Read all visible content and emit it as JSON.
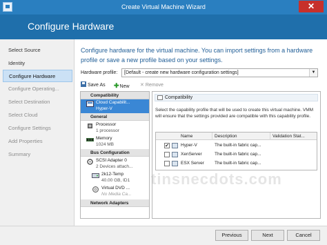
{
  "window": {
    "title": "Create Virtual Machine Wizard",
    "close_glyph": "✕"
  },
  "banner": {
    "title": "Configure Hardware"
  },
  "nav": {
    "items": [
      {
        "label": "Select Source"
      },
      {
        "label": "Identity"
      },
      {
        "label": "Configure Hardware"
      },
      {
        "label": "Configure Operating..."
      },
      {
        "label": "Select Destination"
      },
      {
        "label": "Select Cloud"
      },
      {
        "label": "Configure Settings"
      },
      {
        "label": "Add Properties"
      },
      {
        "label": "Summary"
      }
    ]
  },
  "main": {
    "intro": "Configure hardware for the virtual machine. You can import settings from a hardware profile or save a new profile based on your settings.",
    "profile_label": "Hardware profile:",
    "profile_value": "[Default - create new hardware configuration settings]"
  },
  "toolbar": {
    "save_as": "Save As",
    "new": "New",
    "remove": "Remove"
  },
  "tree": {
    "headers": [
      "Compatibility",
      "General",
      "Bus Configuration",
      "Network Adapters"
    ],
    "cloud_title": "Cloud Capabilit...",
    "cloud_sub": "Hyper-V",
    "processor_title": "Processor",
    "processor_sub": "1 processor",
    "memory_title": "Memory",
    "memory_sub": "1024 MB",
    "scsi_title": "SCSI Adapter 0",
    "scsi_sub": "2 Devices attach...",
    "disk_title": "2k12-Temp",
    "disk_sub": "40.00 GB, ID1",
    "dvd_title": "Virtual DVD ...",
    "dvd_sub": "No Media Ca..."
  },
  "detail": {
    "header": "Compatibility",
    "description": "Select the capability profile that will be used to create this virtual machine. VMM will ensure that the settings provided are compatible with this capability profile.",
    "columns": [
      "Name",
      "Description",
      "Validation Stat..."
    ],
    "rows": [
      {
        "name": "Hyper-V",
        "description": "The built-in fabric cap...",
        "checked": true
      },
      {
        "name": "XenServer",
        "description": "The built-in fabric cap...",
        "checked": false
      },
      {
        "name": "ESX Server",
        "description": "The built-in fabric cap...",
        "checked": false
      }
    ],
    "check_glyph": "✔"
  },
  "footer": {
    "previous": "Previous",
    "next": "Next",
    "cancel": "Cancel"
  },
  "watermark": "tinsnecdots.com",
  "colors": {
    "titlebar": "#2a7fc0",
    "banner": "#1f6fab",
    "selection": "#3a87d5",
    "intro_text": "#1f5d96"
  }
}
